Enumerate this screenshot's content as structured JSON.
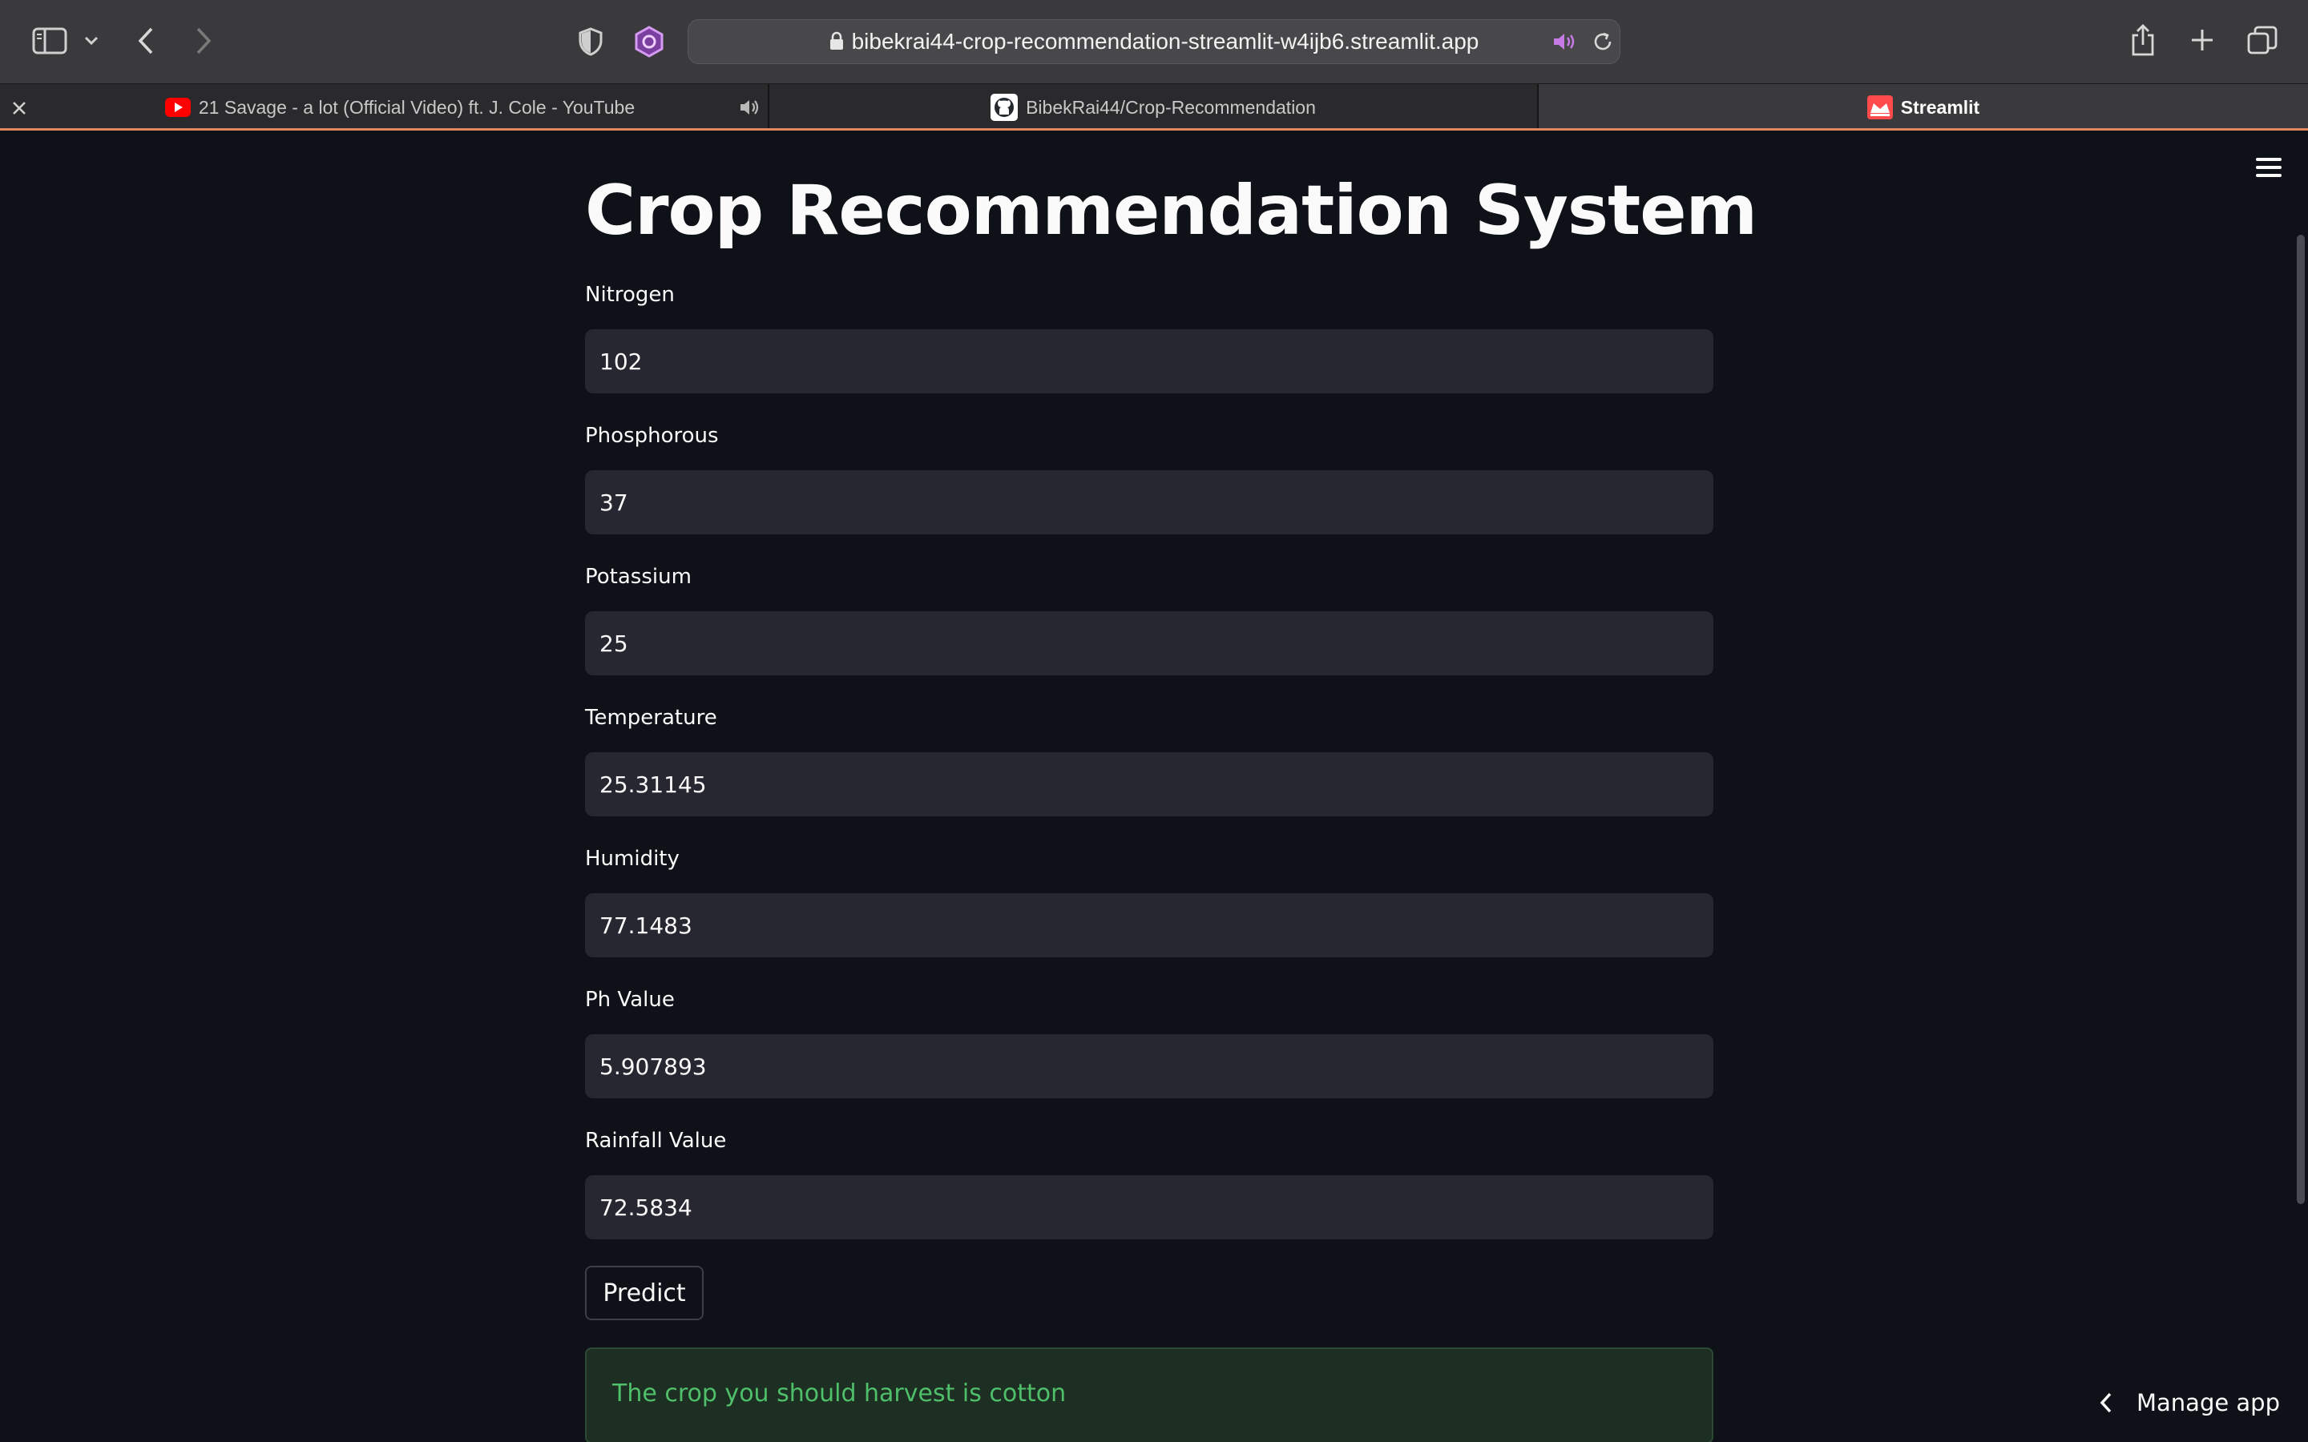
{
  "browser": {
    "url": "bibekrai44-crop-recommendation-streamlit-w4ijb6.streamlit.app",
    "tabs": [
      {
        "label": "21 Savage - a lot (Official Video) ft. J. Cole - YouTube",
        "icon": "youtube-icon",
        "audio": true
      },
      {
        "label": "BibekRai44/Crop-Recommendation",
        "icon": "github-icon"
      },
      {
        "label": "Streamlit",
        "icon": "streamlit-icon",
        "active": true
      }
    ]
  },
  "app": {
    "title": "Crop Recommendation System",
    "fields": [
      {
        "label": "Nitrogen",
        "value": "102"
      },
      {
        "label": "Phosphorous",
        "value": "37"
      },
      {
        "label": "Potassium",
        "value": "25"
      },
      {
        "label": "Temperature",
        "value": "25.31145"
      },
      {
        "label": "Humidity",
        "value": "77.1483"
      },
      {
        "label": "Ph Value",
        "value": "5.907893"
      },
      {
        "label": "Rainfall Value",
        "value": "72.5834"
      }
    ],
    "predict_label": "Predict",
    "result": "The crop you should harvest is cotton",
    "manage_app": "Manage app"
  },
  "colors": {
    "background": "#0e1117",
    "input": "#262730",
    "success_bg": "#1d2f23",
    "success_text": "#4fbf6a",
    "streamlit_red": "#ff4b4b",
    "youtube_red": "#ff0000"
  }
}
